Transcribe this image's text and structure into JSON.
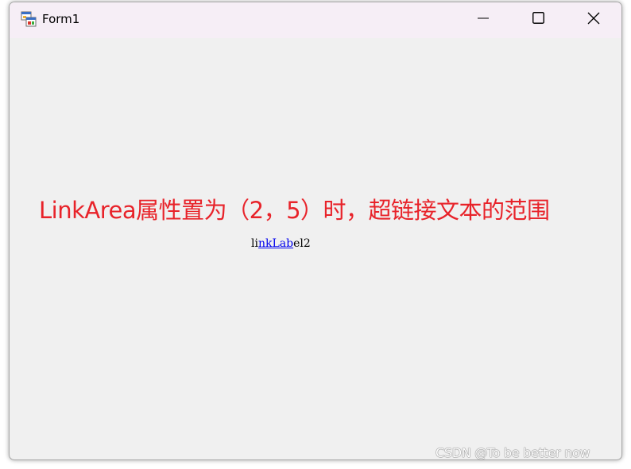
{
  "window": {
    "title": "Form1",
    "icon": "windows-forms-app-icon",
    "controls": {
      "minimize_icon": "minimize-icon",
      "maximize_icon": "maximize-icon",
      "close_icon": "close-icon"
    }
  },
  "form": {
    "caption": "LinkArea属性置为（2，5）时，超链接文本的范围",
    "linklabel": {
      "prefix": "li",
      "link_text": "nkLab",
      "suffix": "el2"
    }
  },
  "watermark": "CSDN @To be better now",
  "colors": {
    "caption": "#e8232a",
    "link": "#0000ee",
    "titlebar": "#f6eef6",
    "client_bg": "#f0f0f0"
  }
}
